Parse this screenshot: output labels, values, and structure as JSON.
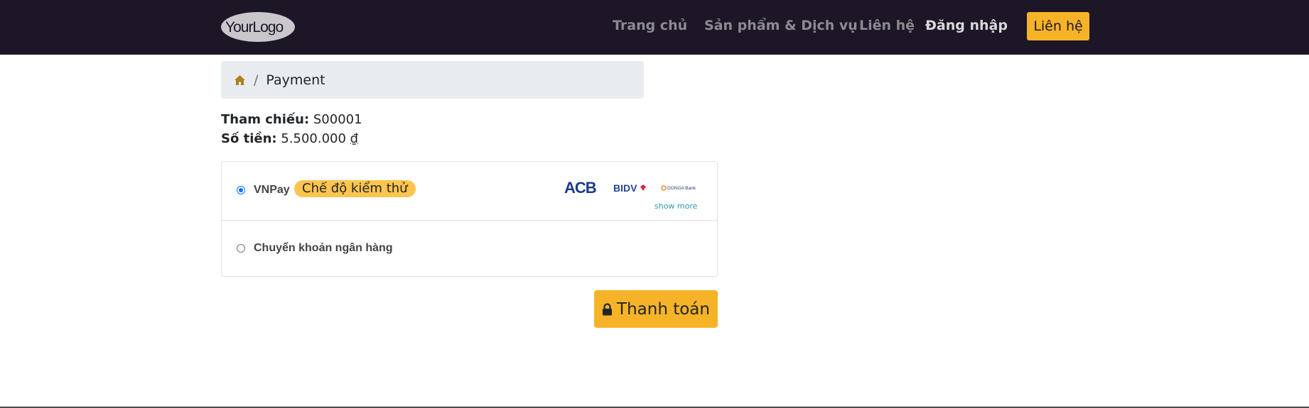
{
  "header": {
    "logo_text": "YourLogo",
    "nav": [
      {
        "label": "Trang chủ"
      },
      {
        "label": "Sản phẩm & Dịch vụ"
      },
      {
        "label": "Liên hệ"
      },
      {
        "label": "Đăng nhập"
      }
    ],
    "cta_label": "Liên hệ"
  },
  "breadcrumb": {
    "home_icon": "home-icon",
    "separator": "/",
    "current": "Payment"
  },
  "order": {
    "reference_label": "Tham chiếu:",
    "reference_value": "S00001",
    "amount_label": "Số tiền:",
    "amount_value": "5.500.000",
    "currency_symbol": "₫"
  },
  "payment_methods": [
    {
      "label": "VNPay",
      "selected": true,
      "badge": "Chế độ kiểm thử",
      "bank_logos": [
        "ACB",
        "BIDV",
        "DONGA Bank"
      ],
      "show_more": "show more"
    },
    {
      "label": "Chuyển khoản ngân hàng",
      "selected": false
    }
  ],
  "pay_button": {
    "icon": "lock-icon",
    "label": "Thanh toán"
  },
  "colors": {
    "navbar_bg": "#1c1627",
    "accent": "#f7b328",
    "badge_bg": "#fdc54e",
    "radio_selected": "#0075ff",
    "link": "#2e9bb0"
  }
}
